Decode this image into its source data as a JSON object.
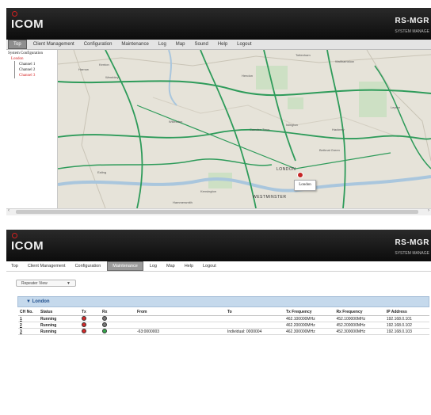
{
  "brand": {
    "name": "ICOM",
    "product": "RS-MGR",
    "product_sub": "SYSTEM MANAGE"
  },
  "top_window": {
    "menu": [
      "Top",
      "Client Management",
      "Configuration",
      "Maintenance",
      "Log",
      "Map",
      "Sound",
      "Help",
      "Logout"
    ],
    "active_menu": "Top",
    "tree": {
      "heading": "System Configuration",
      "root": "London",
      "items": [
        "Channel 1",
        "Channel 2",
        "Channel 3"
      ]
    },
    "map": {
      "city_label": "LONDON",
      "district_label": "WESTMINSTER",
      "popup": "London",
      "place_labels": [
        "Harrow",
        "Kenton",
        "Wembley",
        "Hendon",
        "Willesden",
        "Camden Town",
        "Islington",
        "Hackney",
        "Tottenham",
        "Walthamstow",
        "Bethnal Green",
        "Ealing",
        "Kensington",
        "Hammersmith",
        "Leyton"
      ]
    }
  },
  "bottom_window": {
    "menu": [
      "Top",
      "Client Management",
      "Configuration",
      "Maintenance",
      "Log",
      "Map",
      "Help",
      "Logout"
    ],
    "active_menu": "Maintenance",
    "view_select": "Repeater View",
    "group": "London",
    "columns": [
      "CH No.",
      "Status",
      "Tx",
      "Rx",
      "From",
      "To",
      "Tx Frequency",
      "Rx Frequency",
      "IP Address"
    ],
    "rows": [
      {
        "ch": "1",
        "status": "Running",
        "tx": "red",
        "rx": "gray",
        "from": "",
        "to": "",
        "tx_freq": "462.100000MHz",
        "rx_freq": "452.100000MHz",
        "ip": "192.168.0.101"
      },
      {
        "ch": "2",
        "status": "Running",
        "tx": "red",
        "rx": "gray",
        "from": "",
        "to": "",
        "tx_freq": "462.200000MHz",
        "rx_freq": "452.200000MHz",
        "ip": "192.168.0.102"
      },
      {
        "ch": "3",
        "status": "Running",
        "tx": "red",
        "rx": "green",
        "from": "-63:0000003",
        "to": "Individual: 0000004",
        "tx_freq": "462.300000MHz",
        "rx_freq": "452.300000MHz",
        "ip": "192.168.0.103"
      }
    ]
  },
  "colors": {
    "tx_active": "#d42a2a",
    "rx_idle": "#777777",
    "rx_active": "#34a84a",
    "group_bar": "#c5d9ec",
    "tree_selected": "#d41f1f"
  }
}
